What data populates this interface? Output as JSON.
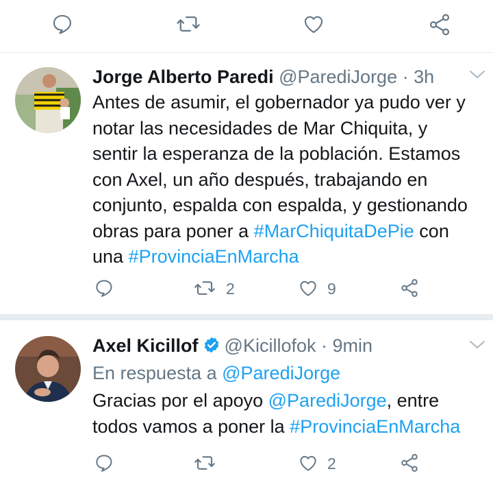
{
  "top_actions": {
    "icons": [
      "reply-icon",
      "retweet-icon",
      "like-icon",
      "share-icon"
    ]
  },
  "tweets": [
    {
      "author_name": "Jorge Alberto Paredi",
      "handle": "@ParediJorge",
      "separator": " · ",
      "time": "3h",
      "text_parts": [
        "Antes de asumir, el gobernador ya pudo ver y",
        "notar las necesidades de Mar Chiquita, y",
        "sentir la esperanza de la población. Estamos",
        "con Axel, un año después, trabajando en",
        "conjunto, espalda con espalda, y gestionando",
        "obras para poner a ",
        "#MarChiquitaDePie",
        " con",
        "una ",
        "#ProvinciaEnMarcha"
      ],
      "retweets": "2",
      "likes": "9"
    },
    {
      "author_name": "Axel Kicillof",
      "handle": "@Kicillofok",
      "separator": " · ",
      "time": "9min",
      "reply_prefix": "En respuesta a ",
      "reply_to": "@ParediJorge",
      "text_parts": [
        "Gracias por el apoyo ",
        "@ParediJorge",
        ", entre",
        "todos vamos a poner la ",
        "#ProvinciaEnMarcha"
      ],
      "likes": "2"
    }
  ],
  "colors": {
    "link": "#1da1f2",
    "muted": "#657786",
    "divider": "#e6ecf0",
    "icon": "#657786",
    "verified": "#1da1f2"
  }
}
